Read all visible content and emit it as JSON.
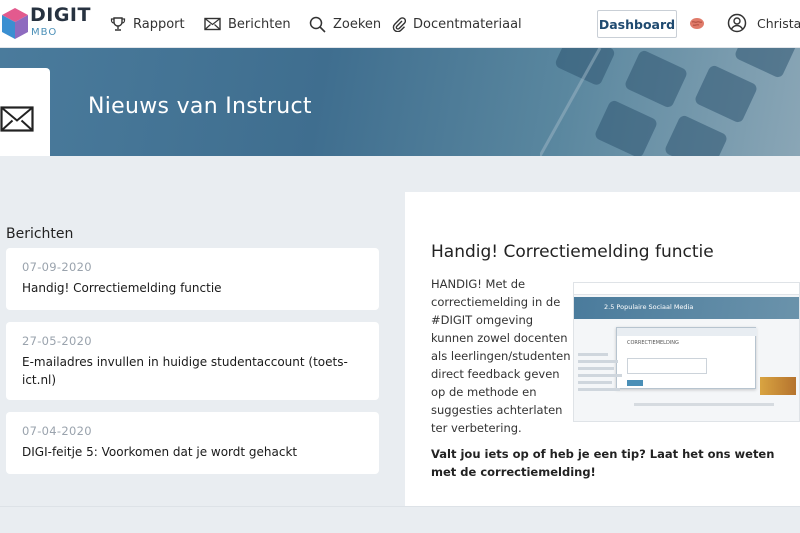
{
  "logo": {
    "word": "DIGIT",
    "sub": "MBO"
  },
  "nav": {
    "items": [
      {
        "label": "Rapport",
        "icon": "trophy-icon"
      },
      {
        "label": "Berichten",
        "icon": "envelope-icon"
      },
      {
        "label": "Zoeken",
        "icon": "search-icon"
      },
      {
        "label": "Docentmateriaal",
        "icon": "paperclip-icon"
      }
    ],
    "dashboard_label": "Dashboard",
    "user_name": "Christa"
  },
  "banner": {
    "title": "Nieuws van Instruct",
    "icon": "envelope-icon"
  },
  "messages": {
    "heading": "Berichten",
    "items": [
      {
        "date": "07-09-2020",
        "title": "Handig! Correctiemelding functie"
      },
      {
        "date": "27-05-2020",
        "title": "E-mailadres invullen in huidige studentaccount (toets-ict.nl)"
      },
      {
        "date": "07-04-2020",
        "title": "DIGI-feitje 5: Voorkomen dat je wordt gehackt"
      }
    ]
  },
  "article": {
    "title": "Handig! Correctiemelding functie",
    "body": "HANDIG! Met de correctiemelding in de #DIGIT omgeving kunnen zowel docenten als leerlingen/studenten direct feedback geven op de methode en suggesties achterlaten ter verbetering.",
    "bold": "Valt jou iets op of heb je een tip? Laat het ons weten met de correctiemelding!",
    "thumb_banner": "2.5 Populaire Sociaal Media",
    "thumb_modal": "CORRECTIEMELDING"
  },
  "colors": {
    "accent": "#1f4a70",
    "banner": "#4a7b9c",
    "bg": "#e9edf1"
  }
}
